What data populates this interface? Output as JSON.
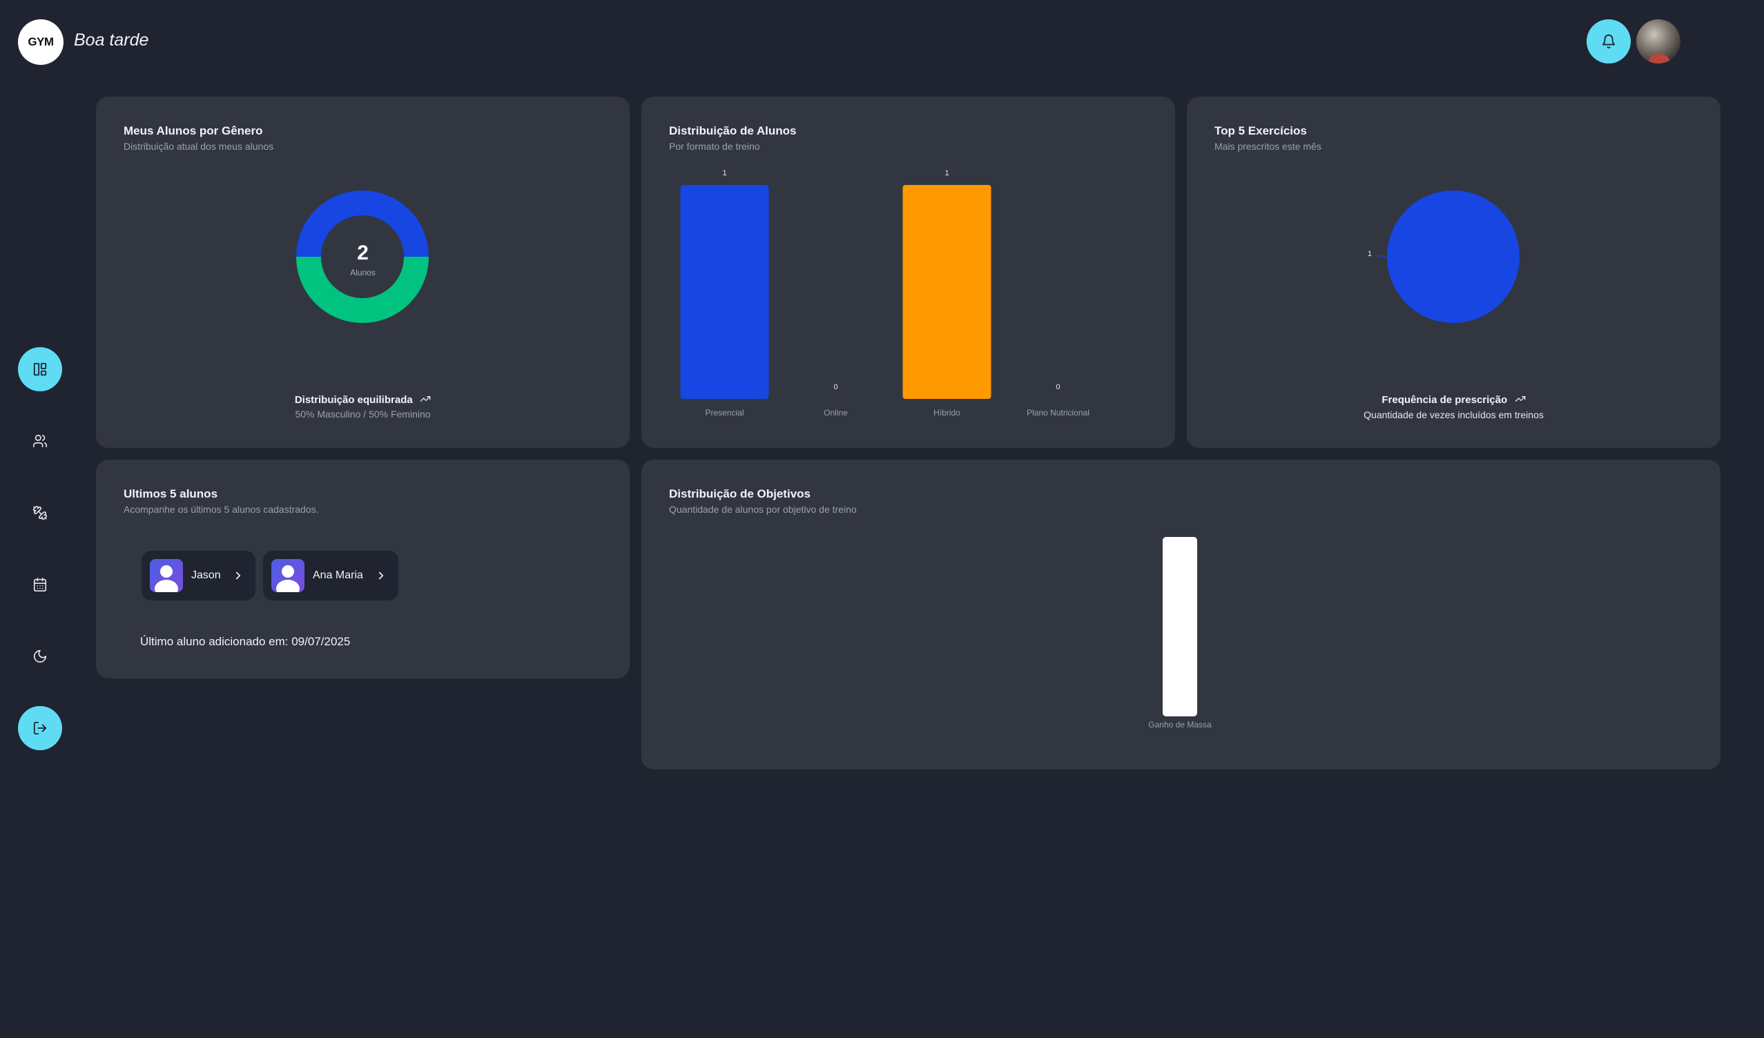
{
  "header": {
    "logo_text": "GYM",
    "greeting": "Boa tarde",
    "notification_icon": "bell-icon",
    "profile_avatar": "user-photo"
  },
  "sidebar": {
    "items": [
      {
        "icon": "dashboard-icon",
        "active": true
      },
      {
        "icon": "users-icon",
        "active": false
      },
      {
        "icon": "dumbbell-icon",
        "active": false
      },
      {
        "icon": "calendar-icon",
        "active": false
      },
      {
        "icon": "moon-icon",
        "active": false
      },
      {
        "icon": "logout-icon",
        "active": true
      }
    ]
  },
  "colors": {
    "background": "#1f2430",
    "card": "#323641",
    "accent": "#5fdcf4",
    "blue": "#1746e3",
    "green": "#00c37f",
    "orange": "#ff9900",
    "white": "#ffffff"
  },
  "gender_card": {
    "title": "Meus Alunos por Gênero",
    "subtitle": "Distribuição atual dos meus alunos",
    "total": "2",
    "total_label": "Alunos",
    "footer_title": "Distribuição equilibrada",
    "footer_text": "50% Masculino / 50% Feminino",
    "chart_data": {
      "type": "pie",
      "donut": true,
      "labels": [
        "Masculino",
        "Feminino"
      ],
      "values": [
        1,
        1
      ],
      "colors": [
        "#1746e3",
        "#00c37f"
      ]
    }
  },
  "distribution_card": {
    "title": "Distribuição de Alunos",
    "subtitle": "Por formato de treino",
    "chart_data": {
      "type": "bar",
      "categories": [
        "Presencial",
        "Online",
        "Híbrido",
        "Plano Nutricional"
      ],
      "values": [
        1,
        0,
        1,
        0
      ],
      "value_labels": [
        "1",
        "0",
        "1",
        "0"
      ],
      "colors": [
        "#1746e3",
        "#1746e3",
        "#ff9900",
        "#ff9900"
      ],
      "ylim": [
        0,
        1
      ]
    }
  },
  "exercises_card": {
    "title": "Top 5 Exercícios",
    "subtitle": "Mais prescritos este mês",
    "slice_label": "1",
    "footer_title": "Frequência de prescrição",
    "footer_text": "Quantidade de vezes incluídos em treinos",
    "chart_data": {
      "type": "pie",
      "values": [
        1
      ],
      "colors": [
        "#1746e3"
      ]
    }
  },
  "latest_students": {
    "title": "Ultimos 5 alunos",
    "subtitle": "Acompanhe os últimos 5 alunos cadastrados.",
    "students": [
      {
        "name": "Jason"
      },
      {
        "name": "Ana Maria"
      }
    ],
    "last_added": "Último aluno adicionado em: 09/07/2025"
  },
  "objectives_card": {
    "title": "Distribuição de Objetivos",
    "subtitle": "Quantidade de alunos por objetivo de treino",
    "chart_data": {
      "type": "bar",
      "categories": [
        "Ganho de Massa"
      ],
      "values": [
        1
      ],
      "colors": [
        "#ffffff"
      ],
      "ylim": [
        0,
        1
      ]
    }
  }
}
